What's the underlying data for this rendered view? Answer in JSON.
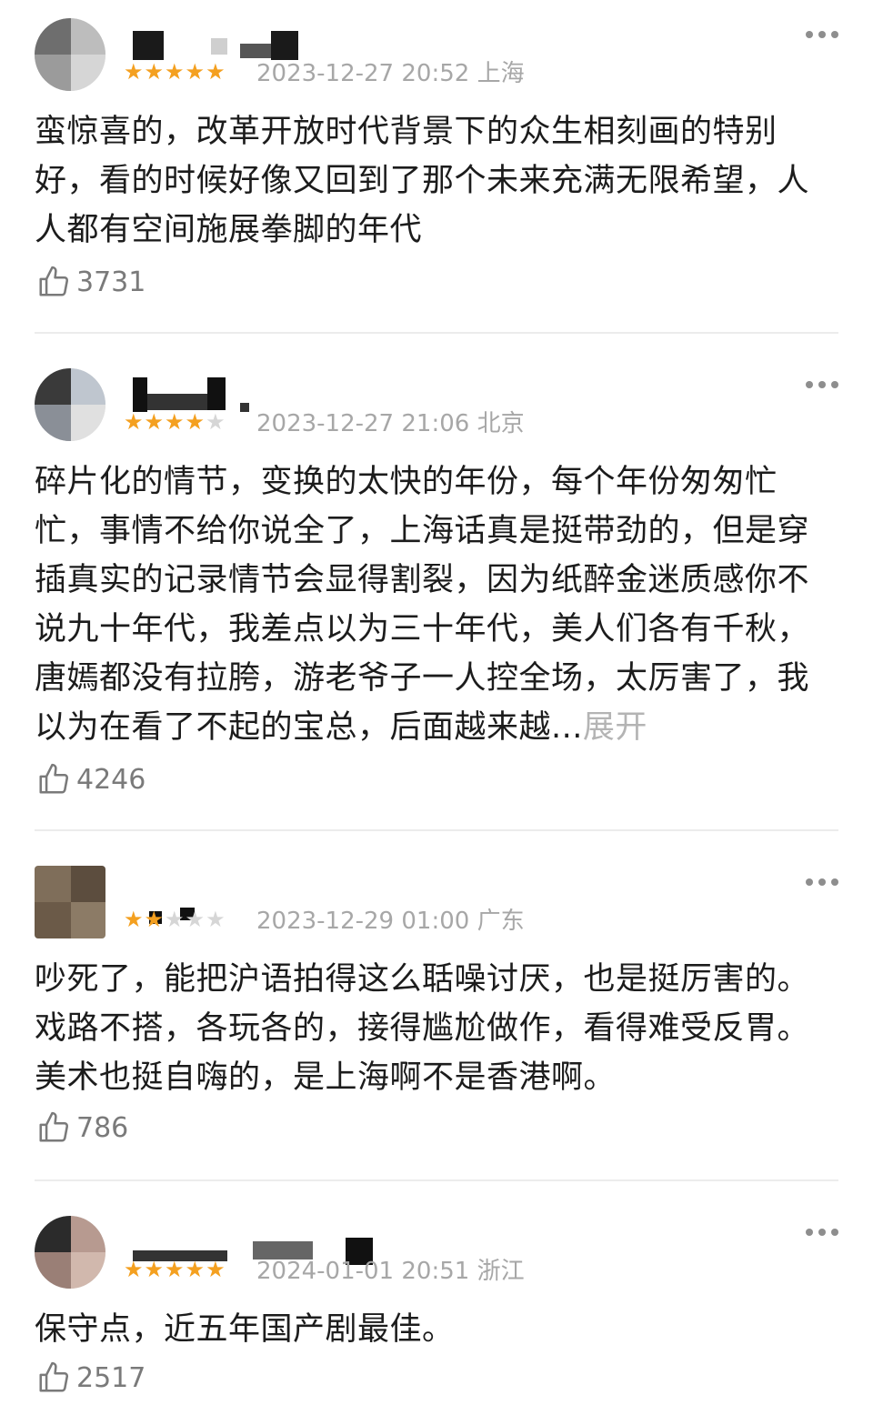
{
  "comments": [
    {
      "stars": 5,
      "date": "2023-12-27 20:52",
      "location": "上海",
      "text": "蛮惊喜的，改革开放时代背景下的众生相刻画的特别好，看的时候好像又回到了那个未来充满无限希望，人人都有空间施展拳脚的年代",
      "likes": "3731",
      "expand": ""
    },
    {
      "stars": 4,
      "date": "2023-12-27 21:06",
      "location": "北京",
      "text": "碎片化的情节，变换的太快的年份，每个年份匆匆忙忙，事情不给你说全了，上海话真是挺带劲的，但是穿插真实的记录情节会显得割裂，因为纸醉金迷质感你不说九十年代，我差点以为三十年代，美人们各有千秋，唐嫣都没有拉胯，游老爷子一人控全场，太厉害了，我以为在看了不起的宝总，后面越来越...",
      "likes": "4246",
      "expand": "展开"
    },
    {
      "stars": 2,
      "date": "2023-12-29 01:00",
      "location": "广东",
      "text": "吵死了，能把沪语拍得这么聒噪讨厌，也是挺厉害的。戏路不搭，各玩各的，接得尴尬做作，看得难受反胃。美术也挺自嗨的，是上海啊不是香港啊。",
      "likes": "786",
      "expand": ""
    },
    {
      "stars": 5,
      "date": "2024-01-01 20:51",
      "location": "浙江",
      "text": "保守点，近五年国产剧最佳。",
      "likes": "2517",
      "expand": ""
    }
  ],
  "icons": {
    "like": "thumbs-up-icon",
    "more": "more-dots-icon",
    "star": "star-icon"
  },
  "colors": {
    "star_on": "#f4a020",
    "star_off": "#d6d6d6",
    "meta": "#a7a7a7",
    "expand": "#b4b4b4"
  }
}
